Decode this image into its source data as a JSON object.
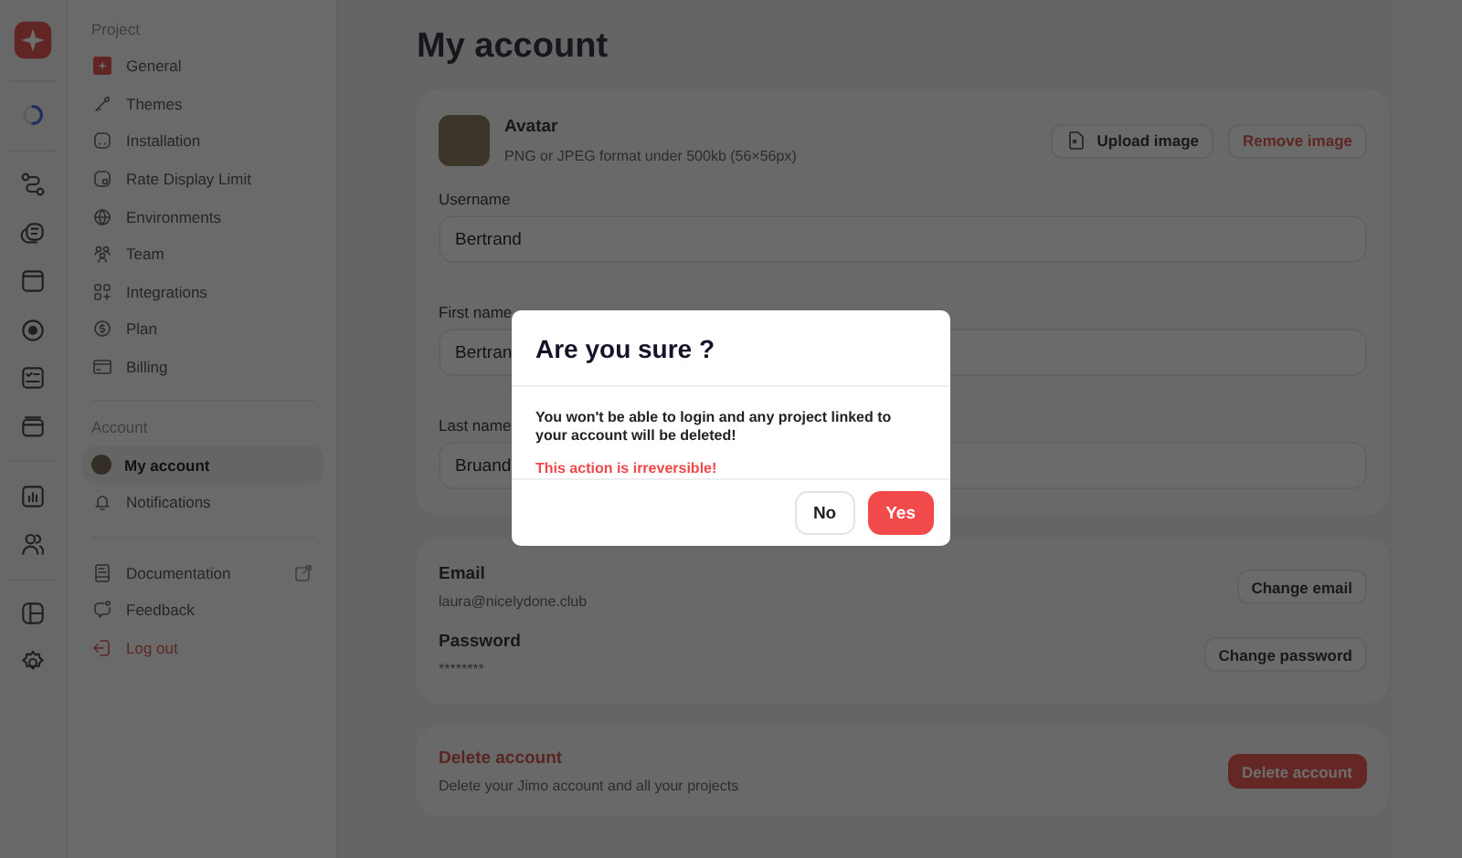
{
  "nav": {
    "sections": [
      {
        "title": "Project",
        "items": [
          {
            "label": "General",
            "kind": "page",
            "selected": false
          },
          {
            "label": "Themes",
            "kind": "page",
            "selected": false
          },
          {
            "label": "Installation",
            "kind": "page",
            "selected": false
          },
          {
            "label": "Rate Display Limit",
            "kind": "page",
            "selected": false
          },
          {
            "label": "Environments",
            "kind": "page",
            "selected": false
          },
          {
            "label": "Team",
            "kind": "page",
            "selected": false
          },
          {
            "label": "Integrations",
            "kind": "page",
            "selected": false
          },
          {
            "label": "Plan",
            "kind": "page",
            "selected": false
          },
          {
            "label": "Billing",
            "kind": "page",
            "selected": false
          }
        ]
      },
      {
        "title": "Account",
        "items": [
          {
            "label": "My account",
            "kind": "page",
            "selected": true
          },
          {
            "label": "Notifications",
            "kind": "page",
            "selected": false
          }
        ]
      },
      {
        "items": [
          {
            "label": "Documentation",
            "kind": "external",
            "selected": false
          },
          {
            "label": "Feedback",
            "kind": "page",
            "selected": false
          },
          {
            "label": "Log out",
            "kind": "danger",
            "selected": false
          }
        ]
      }
    ]
  },
  "page": {
    "title": "My account",
    "avatar": {
      "label": "Avatar",
      "hint": "PNG or JPEG format under 500kb (56×56px)",
      "upload_button": "Upload image",
      "remove_button": "Remove image"
    },
    "fields": [
      {
        "label": "Username",
        "value": "Bertrand"
      },
      {
        "label": "First name",
        "value": "Bertran"
      },
      {
        "label": "Last name",
        "value": "Bruand"
      }
    ],
    "credentials": [
      {
        "label": "Email",
        "value": "laura@nicelydone.club",
        "button": "Change email"
      },
      {
        "label": "Password",
        "value": "********",
        "button": "Change password"
      }
    ],
    "danger_zone": {
      "title": "Delete account",
      "text": "Delete your Jimo account and all your projects",
      "button": "Delete account"
    }
  },
  "modal": {
    "title": "Are you sure ?",
    "message": "You won't be able to login and any project linked to your account will be deleted!",
    "warning": "This action is irreversible!",
    "buttons": [
      {
        "label": "No",
        "kind": "secondary"
      },
      {
        "label": "Yes",
        "kind": "primary"
      }
    ]
  }
}
